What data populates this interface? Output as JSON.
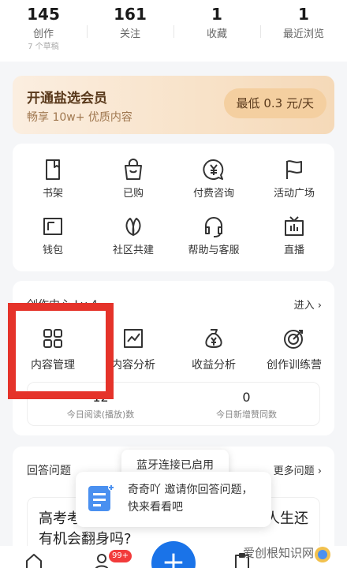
{
  "stats": [
    {
      "num": "145",
      "label": "创作",
      "sub": "7 个草稿"
    },
    {
      "num": "161",
      "label": "关注",
      "sub": ""
    },
    {
      "num": "1",
      "label": "收藏",
      "sub": ""
    },
    {
      "num": "1",
      "label": "最近浏览",
      "sub": ""
    }
  ],
  "vip": {
    "title": "开通盐选会员",
    "subtitle": "畅享 10w+ 优质内容",
    "price": "最低 0.3 元/天"
  },
  "grid": [
    {
      "label": "书架",
      "icon": "bookshelf-icon"
    },
    {
      "label": "已购",
      "icon": "shopping-bag-icon"
    },
    {
      "label": "付费咨询",
      "icon": "yen-chat-icon"
    },
    {
      "label": "活动广场",
      "icon": "flag-icon"
    },
    {
      "label": "钱包",
      "icon": "wallet-icon"
    },
    {
      "label": "社区共建",
      "icon": "leaf-icon"
    },
    {
      "label": "帮助与客服",
      "icon": "headset-icon"
    },
    {
      "label": "直播",
      "icon": "tv-icon"
    }
  ],
  "creator": {
    "title": "创作中心 Lv 4",
    "enter": "进入",
    "items": [
      {
        "label": "内容管理",
        "icon": "grid-icon"
      },
      {
        "label": "内容分析",
        "icon": "chart-icon"
      },
      {
        "label": "收益分析",
        "icon": "money-bag-icon"
      },
      {
        "label": "创作训练营",
        "icon": "target-icon"
      }
    ],
    "metrics": [
      {
        "value": "12",
        "label": "今日阅读(播放)数"
      },
      {
        "value": "0",
        "label": "今日新增赞同数"
      }
    ]
  },
  "answer": {
    "title": "回答问题",
    "more": "更多问题",
    "question": "高考考砸了怎么办，回顾一下，我的人生还有机会翻身吗?"
  },
  "toast": "蓝牙连接已启用",
  "invite": {
    "line1": "奇奇吖 邀请你回答问题，",
    "line2": "快来看看吧"
  },
  "tabbar": {
    "badge": "99+",
    "plus": "+",
    "watermark": "爱创根知识网"
  },
  "colors": {
    "accent": "#1a73e8",
    "highlight": "#e5332a",
    "vip_bg": "#f8e2c8"
  }
}
